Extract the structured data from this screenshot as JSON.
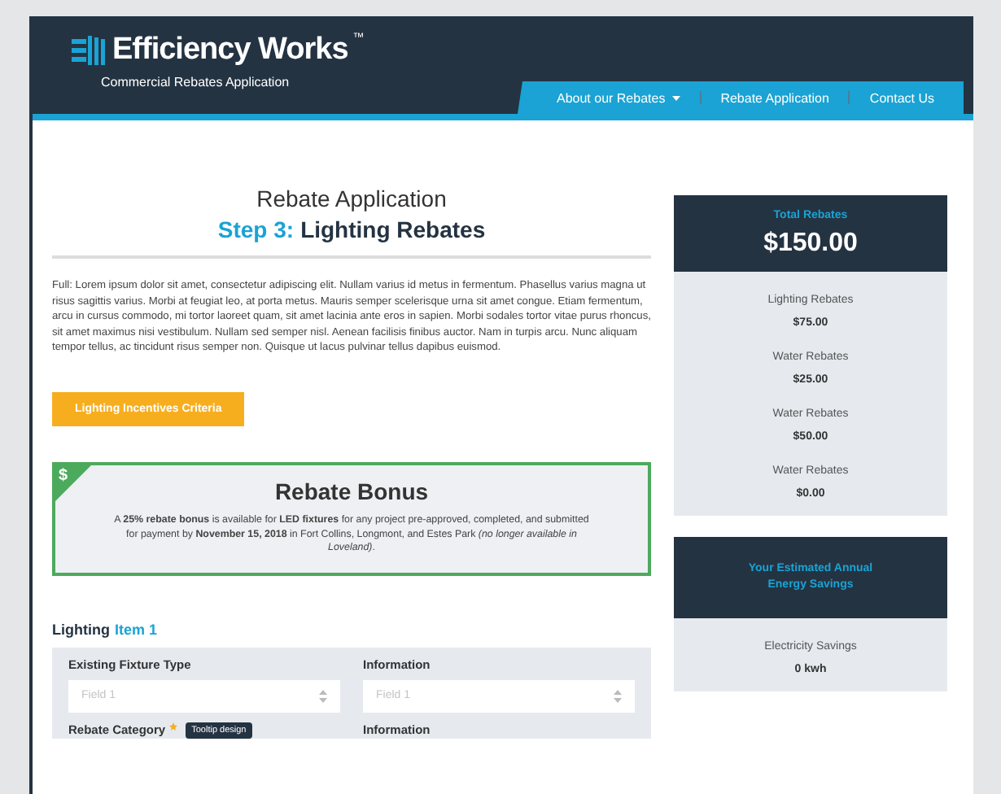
{
  "header": {
    "brand": "Efficiency Works",
    "trademark": "™",
    "subtitle": "Commercial Rebates Application",
    "nav": [
      {
        "label": "About our Rebates",
        "dropdown": true
      },
      {
        "label": "Rebate Application",
        "dropdown": false
      },
      {
        "label": "Contact Us",
        "dropdown": false
      }
    ]
  },
  "main": {
    "title": "Rebate Application",
    "step_label": "Step 3:",
    "step_title": "Lighting Rebates",
    "intro": "Full: Lorem ipsum dolor sit amet, consectetur adipiscing elit. Nullam varius id metus in fermentum. Phasellus varius magna ut risus sagittis varius. Morbi at feugiat leo, at porta metus. Mauris semper scelerisque urna sit amet congue. Etiam fermentum, arcu in cursus commodo, mi tortor laoreet quam, sit amet lacinia ante eros in sapien. Morbi sodales tortor vitae purus rhoncus, sit amet maximus nisi vestibulum. Nullam sed semper nisl. Aenean facilisis finibus auctor. Nam in turpis arcu. Nunc aliquam tempor tellus, ac tincidunt risus semper non. Quisque ut lacus pulvinar tellus dapibus euismod.",
    "criteria_button": "Lighting Incentives Criteria",
    "bonus": {
      "badge": "$",
      "title": "Rebate Bonus",
      "text": "A **25% rebate bonus** is available for **LED fixtures** for any project pre-approved, completed, and submitted for payment by **November 15, 2018** in Fort Collins, Longmont, and Estes Park *(no longer available in Loveland)*."
    },
    "item_label": "Lighting",
    "item_number": "Item 1",
    "form_rows": [
      {
        "fields": [
          {
            "label": "Existing Fixture Type",
            "placeholder": "Field 1",
            "required": false
          },
          {
            "label": "Information",
            "placeholder": "Field 1",
            "required": false
          }
        ]
      },
      {
        "fields": [
          {
            "label": "Rebate Category",
            "required": true,
            "tooltip": "Tooltip design"
          },
          {
            "label": "Information",
            "required": false
          }
        ]
      }
    ]
  },
  "sidebar": {
    "panels": [
      {
        "title": "Total Rebates",
        "total": "$150.00",
        "rows": [
          {
            "label": "Lighting Rebates",
            "value": "$75.00"
          },
          {
            "label": "Water Rebates",
            "value": "$25.00"
          },
          {
            "label": "Water Rebates",
            "value": "$50.00"
          },
          {
            "label": "Water Rebates",
            "value": "$0.00"
          }
        ]
      },
      {
        "title": "Your Estimated Annual Energy Savings",
        "rows": [
          {
            "label": "Electricity Savings",
            "value": "0 kwh"
          }
        ]
      }
    ]
  }
}
